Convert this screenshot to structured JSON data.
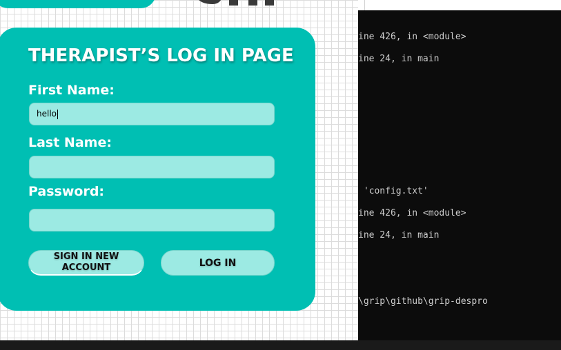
{
  "form": {
    "title": "THERAPIST’S LOG IN PAGE",
    "first_name_label": "First Name:",
    "first_name_value": "hello",
    "last_name_label": "Last Name:",
    "last_name_value": "",
    "password_label": "Password:",
    "password_value": "",
    "signup_label_line1": "SIGN IN NEW",
    "signup_label_line2": "ACCOUNT",
    "login_label": "LOG IN"
  },
  "colors": {
    "card": "#00bfb3",
    "input": "#9ceae3",
    "terminal_bg": "#0c0c0c",
    "terminal_text": "#cccccc"
  },
  "terminal": {
    "lines": [
      "ine 426, in <module>",
      "ine 24, in main",
      " 'config.txt'",
      "ine 426, in <module>",
      "ine 24, in main",
      "\\grip\\github\\grip-despro"
    ]
  }
}
